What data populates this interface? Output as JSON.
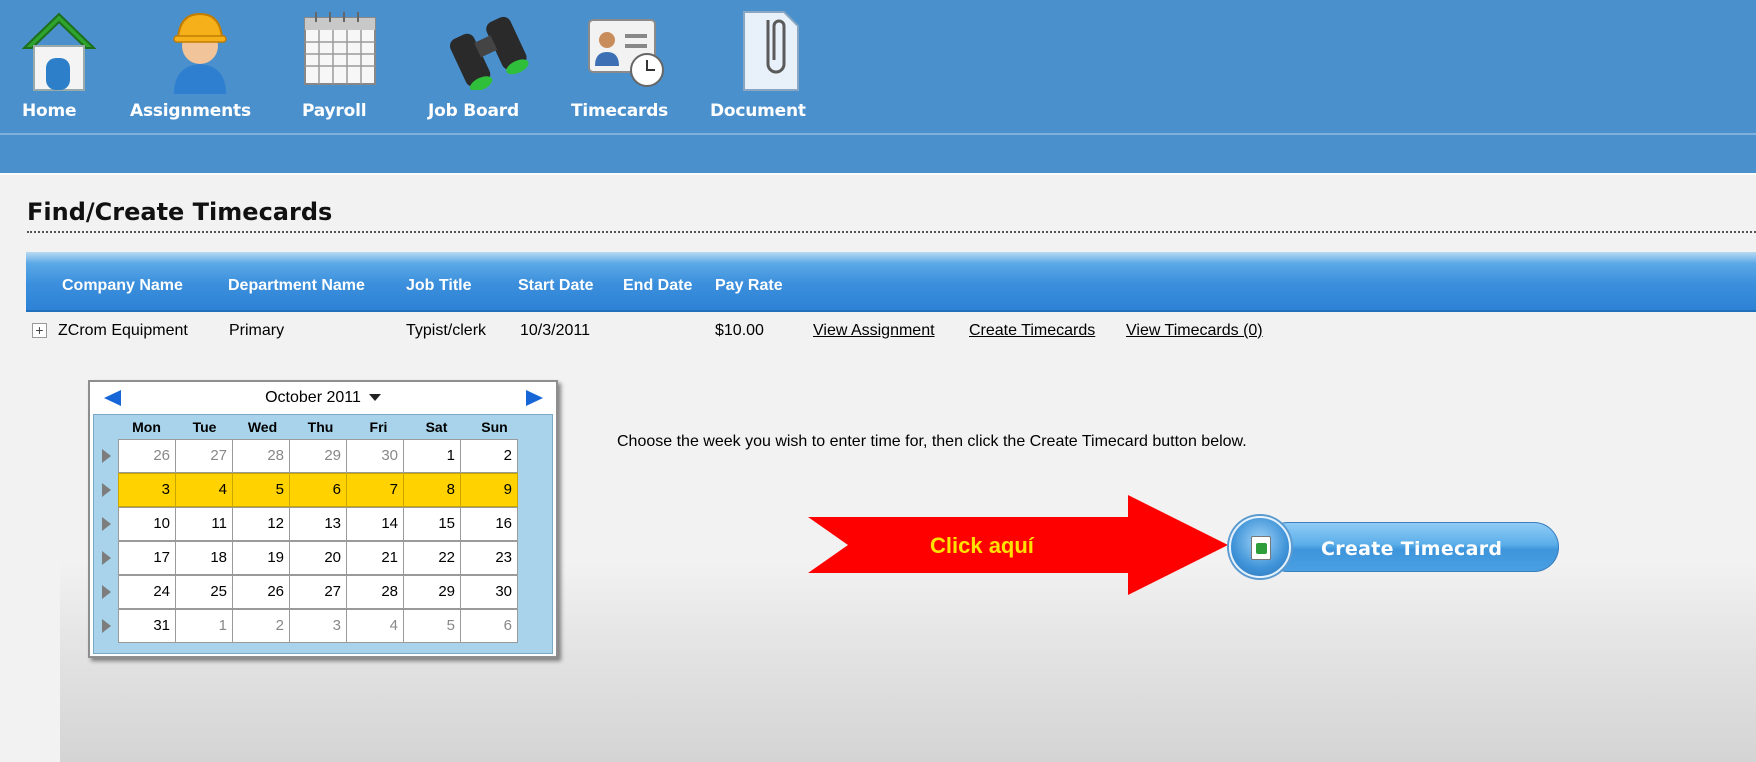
{
  "nav": {
    "items": [
      {
        "label": "Home",
        "icon": "house-icon"
      },
      {
        "label": "Assignments",
        "icon": "worker-hardhat-icon"
      },
      {
        "label": "Payroll",
        "icon": "calendar-grid-icon"
      },
      {
        "label": "Job Board",
        "icon": "binoculars-icon"
      },
      {
        "label": "Timecards",
        "icon": "id-card-clock-icon"
      },
      {
        "label": "Document",
        "icon": "paperclip-document-icon"
      }
    ]
  },
  "page": {
    "title": "Find/Create Timecards"
  },
  "grid": {
    "columns": [
      "Company Name",
      "Department Name",
      "Job Title",
      "Start Date",
      "End Date",
      "Pay Rate"
    ],
    "row": {
      "expander": "+",
      "company": "ZCrom Equipment",
      "department": "Primary",
      "job_title": "Typist/clerk",
      "start_date": "10/3/2011",
      "end_date": "",
      "pay_rate": "$10.00",
      "links": [
        "View Assignment",
        "Create Timecards",
        "View Timecards (0)"
      ]
    }
  },
  "calendar": {
    "month_label": "October 2011",
    "weekdays": [
      "Mon",
      "Tue",
      "Wed",
      "Thu",
      "Fri",
      "Sat",
      "Sun"
    ],
    "selected_week_index": 1,
    "weeks": [
      [
        {
          "d": "26",
          "other": true
        },
        {
          "d": "27",
          "other": true
        },
        {
          "d": "28",
          "other": true
        },
        {
          "d": "29",
          "other": true
        },
        {
          "d": "30",
          "other": true
        },
        {
          "d": "1"
        },
        {
          "d": "2"
        }
      ],
      [
        {
          "d": "3"
        },
        {
          "d": "4"
        },
        {
          "d": "5"
        },
        {
          "d": "6"
        },
        {
          "d": "7"
        },
        {
          "d": "8"
        },
        {
          "d": "9"
        }
      ],
      [
        {
          "d": "10"
        },
        {
          "d": "11"
        },
        {
          "d": "12"
        },
        {
          "d": "13"
        },
        {
          "d": "14"
        },
        {
          "d": "15"
        },
        {
          "d": "16"
        }
      ],
      [
        {
          "d": "17"
        },
        {
          "d": "18"
        },
        {
          "d": "19"
        },
        {
          "d": "20"
        },
        {
          "d": "21"
        },
        {
          "d": "22"
        },
        {
          "d": "23"
        }
      ],
      [
        {
          "d": "24"
        },
        {
          "d": "25"
        },
        {
          "d": "26"
        },
        {
          "d": "27"
        },
        {
          "d": "28"
        },
        {
          "d": "29"
        },
        {
          "d": "30"
        }
      ],
      [
        {
          "d": "31"
        },
        {
          "d": "1",
          "other": true
        },
        {
          "d": "2",
          "other": true
        },
        {
          "d": "3",
          "other": true
        },
        {
          "d": "4",
          "other": true
        },
        {
          "d": "5",
          "other": true
        },
        {
          "d": "6",
          "other": true
        }
      ]
    ]
  },
  "instruction": "Choose the week you wish to enter time for, then click the Create Timecard button below.",
  "callout": {
    "label": "Click aquí",
    "color": "#ff0000"
  },
  "button": {
    "label": "Create Timecard"
  },
  "colors": {
    "nav_bg": "#4a90cc",
    "selected_week": "#ffd200",
    "grid_header": "#3b8fdc"
  }
}
